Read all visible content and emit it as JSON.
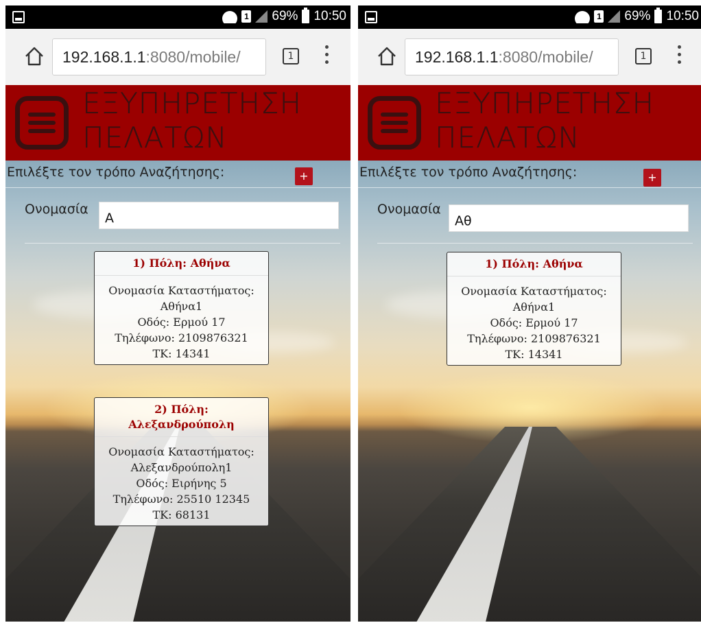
{
  "status_bar": {
    "sim_label": "1",
    "battery": "69%",
    "time": "10:50"
  },
  "browser": {
    "url_host": "192.168.1.1",
    "url_rest": ":8080/mobile/",
    "tab_count": "1"
  },
  "header": {
    "title_line1": "ΕΞΥΠΗΡΕΤΗΣΗ",
    "title_line2": "ΠΕΛΑΤΩΝ"
  },
  "search_mode": {
    "label": "Επιλέξτε τον τρόπο Αναζήτησης:",
    "add_label": "+"
  },
  "name_field_label": "Ονομασία",
  "screens": [
    {
      "search_value": "Α",
      "results": [
        {
          "title": "1) Πόλη: Αθήνα",
          "store_label": "Ονομασία Καταστήματος:",
          "store_name": "Αθήνα1",
          "street": "Οδός: Ερμού 17",
          "phone": "Τηλέφωνο: 2109876321",
          "postcode": "ΤΚ: 14341"
        },
        {
          "title_line1": "2) Πόλη:",
          "title_line2": "Αλεξανδρούπολη",
          "store_label": "Ονομασία Καταστήματος:",
          "store_name": "Αλεξανδρούπολη1",
          "street": "Οδός: Ειρήνης 5",
          "phone": "Τηλέφωνο: 25510 12345",
          "postcode": "ΤΚ: 68131"
        }
      ]
    },
    {
      "search_value": "Αθ",
      "results": [
        {
          "title": "1) Πόλη: Αθήνα",
          "store_label": "Ονομασία Καταστήματος:",
          "store_name": "Αθήνα1",
          "street": "Οδός: Ερμού 17",
          "phone": "Τηλέφωνο: 2109876321",
          "postcode": "ΤΚ: 14341"
        }
      ]
    }
  ],
  "icons": {
    "notification": "notification-icon",
    "wifi": "wifi-icon",
    "sim": "sim-icon",
    "signal": "signal-icon",
    "battery": "battery-icon",
    "home": "home-icon",
    "tabs": "tab-switcher-icon",
    "menu": "more-menu-icon",
    "logo": "menu-logo-icon"
  },
  "colors": {
    "header_bg": "#9b0000",
    "header_text": "#3a1010",
    "plus_button": "#b3121b",
    "card_title": "#9b0000"
  }
}
